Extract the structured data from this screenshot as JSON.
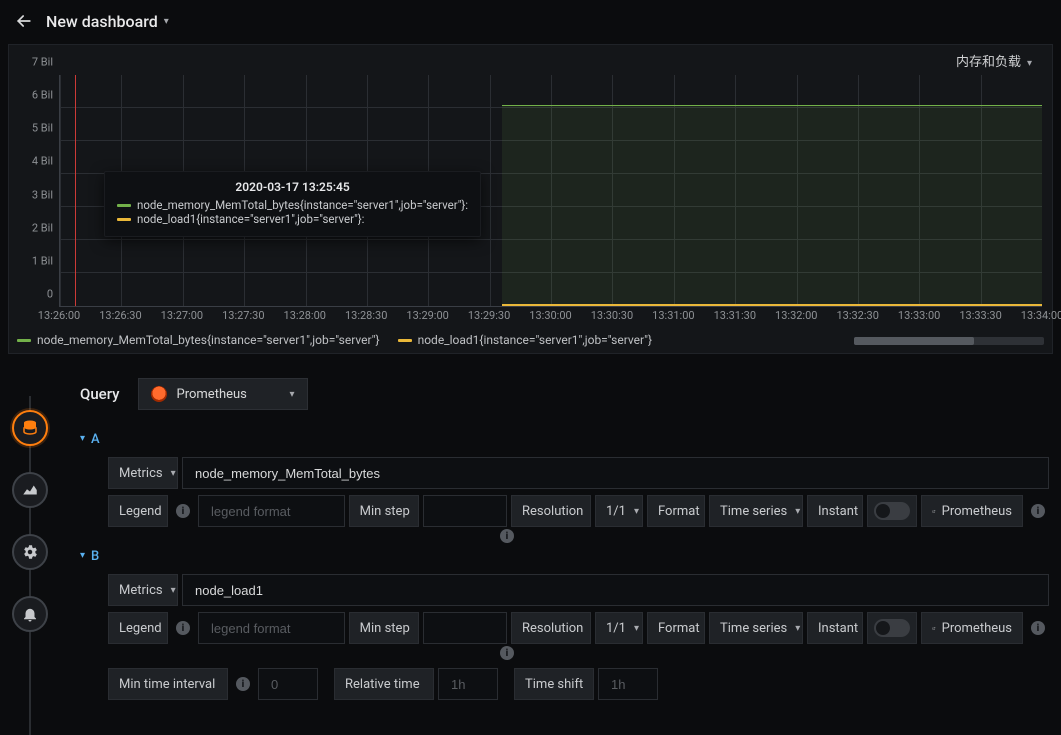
{
  "header": {
    "title": "New dashboard"
  },
  "panel": {
    "title": "内存和负载",
    "tooltip": {
      "time": "2020-03-17 13:25:45",
      "rows": [
        {
          "label": "node_memory_MemTotal_bytes{instance=\"server1\",job=\"server\"}:",
          "color": "#73b14a"
        },
        {
          "label": "node_load1{instance=\"server1\",job=\"server\"}:",
          "color": "#eab839"
        }
      ]
    },
    "legend": [
      {
        "label": "node_memory_MemTotal_bytes{instance=\"server1\",job=\"server\"}",
        "color": "#73b14a"
      },
      {
        "label": "node_load1{instance=\"server1\",job=\"server\"}",
        "color": "#eab839"
      }
    ]
  },
  "chart_data": {
    "type": "line",
    "xlabel": "",
    "ylabel": "",
    "ylim": [
      0,
      7000000000
    ],
    "y_ticks": [
      "0",
      "1 Bil",
      "2 Bil",
      "3 Bil",
      "4 Bil",
      "5 Bil",
      "6 Bil",
      "7 Bil"
    ],
    "x_ticks": [
      "13:26:00",
      "13:26:30",
      "13:27:00",
      "13:27:30",
      "13:28:00",
      "13:28:30",
      "13:29:00",
      "13:29:30",
      "13:30:00",
      "13:30:30",
      "13:31:00",
      "13:31:30",
      "13:32:00",
      "13:32:30",
      "13:33:00",
      "13:33:30",
      "13:34:00"
    ],
    "series": [
      {
        "name": "node_memory_MemTotal_bytes{instance=\"server1\",job=\"server\"}",
        "color": "#73b14a",
        "segments": [
          {
            "x_start": "13:29:30",
            "x_end": "13:34:00",
            "value": 6200000000
          }
        ]
      },
      {
        "name": "node_load1{instance=\"server1\",job=\"server\"}",
        "color": "#eab839",
        "segments": [
          {
            "x_start": "13:29:30",
            "x_end": "13:34:00",
            "value": 0
          }
        ]
      }
    ],
    "marker_x": "13:25:45"
  },
  "editor": {
    "query_label": "Query",
    "datasource": "Prometheus",
    "labels": {
      "metrics": "Metrics",
      "legend": "Legend",
      "legend_ph": "legend format",
      "minstep": "Min step",
      "resolution": "Resolution",
      "res_val": "1/1",
      "format": "Format",
      "format_val": "Time series",
      "instant": "Instant",
      "ext": "Prometheus",
      "min_int": "Min time interval",
      "min_int_ph": "0",
      "rel_time": "Relative time",
      "rel_ph": "1h",
      "shift": "Time shift",
      "shift_ph": "1h"
    },
    "queries": [
      {
        "id": "A",
        "metric": "node_memory_MemTotal_bytes"
      },
      {
        "id": "B",
        "metric": "node_load1"
      }
    ]
  }
}
